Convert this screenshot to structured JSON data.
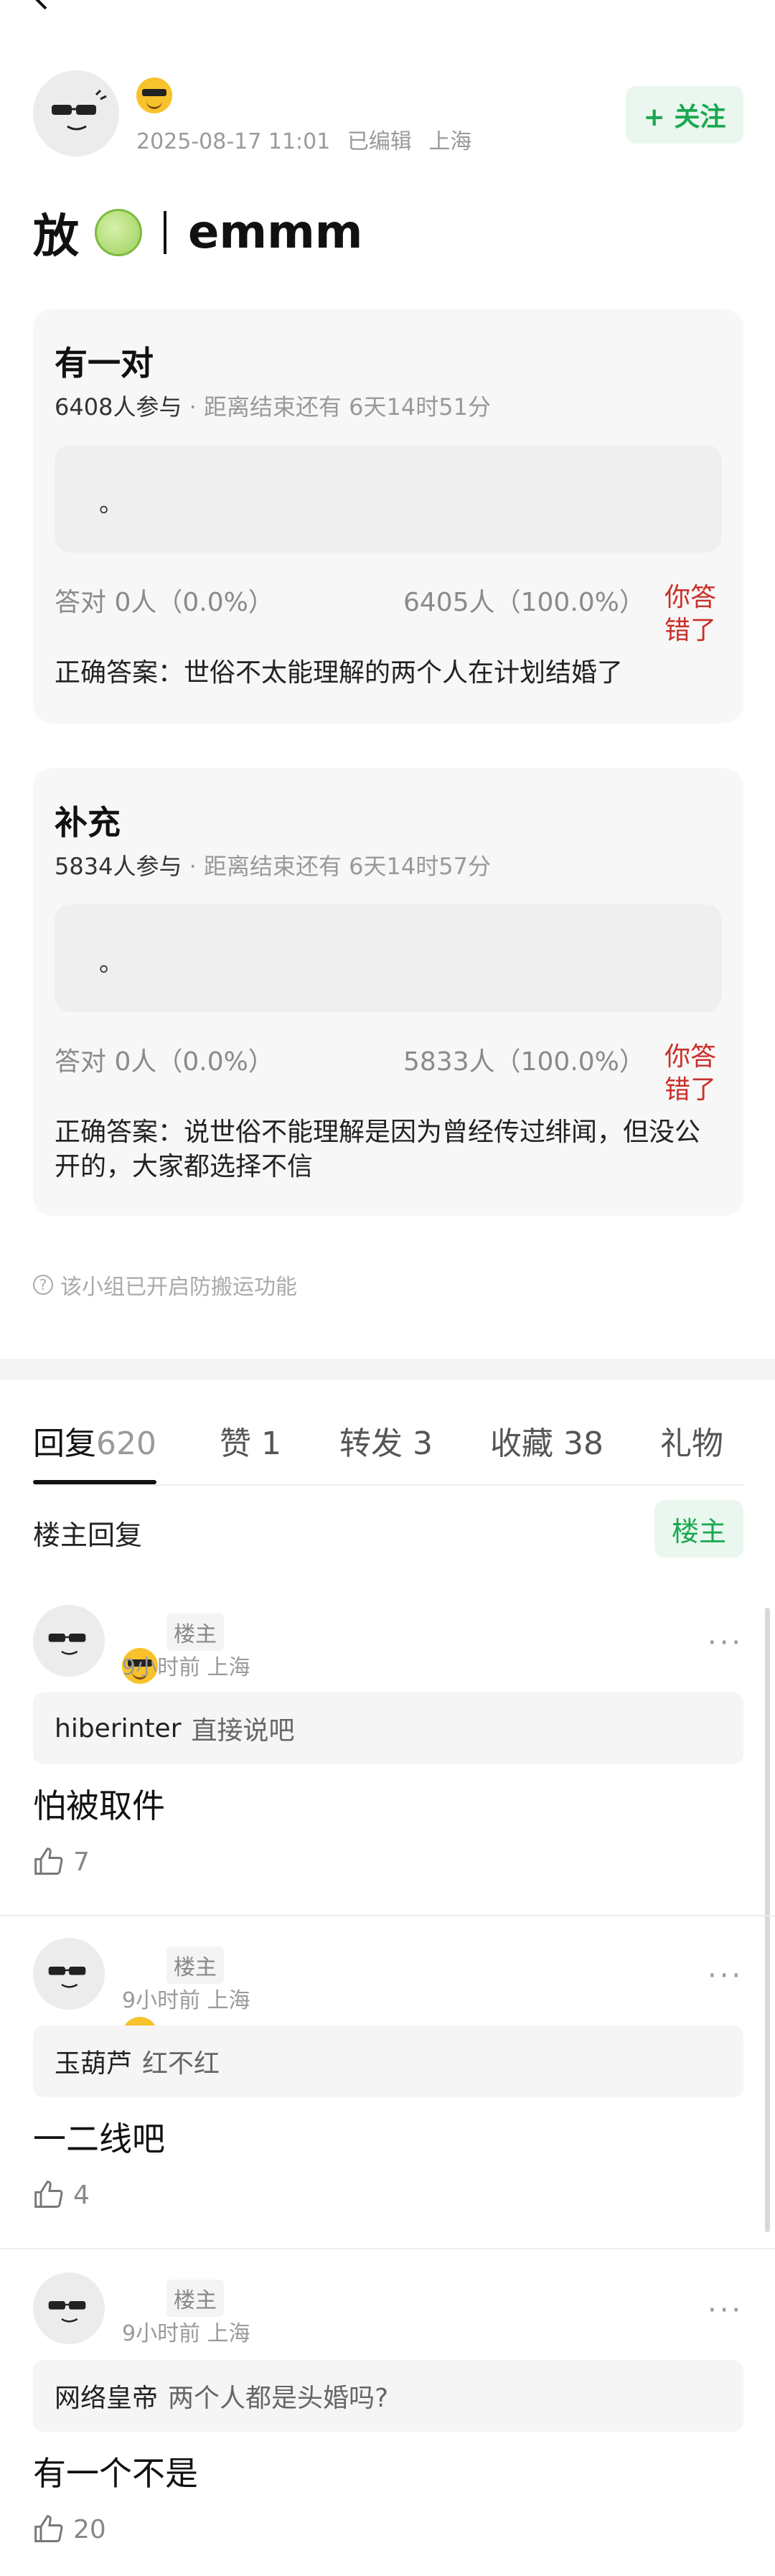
{
  "post": {
    "date": "2025-08-17 11:01",
    "edited": "已编辑",
    "location": "上海",
    "follow_label": "+ 关注",
    "title_left": "放",
    "title_right": "emmm"
  },
  "polls": [
    {
      "title": "有一对",
      "participants": "6408人参与",
      "deadline": "· 距离结束还有 6天14时51分",
      "option": "。",
      "correct_result": "答对  0人（0.0%）",
      "other_result": "6405人（100.0%）",
      "wrong_label": "你答错了",
      "answer": "正确答案：世俗不太能理解的两个人在计划结婚了"
    },
    {
      "title": "补充",
      "participants": "5834人参与",
      "deadline": "· 距离结束还有 6天14时57分",
      "option": "。",
      "correct_result": "答对  0人（0.0%）",
      "other_result": "5833人（100.0%）",
      "wrong_label": "你答错了",
      "answer": "正确答案：说世俗不能理解是因为曾经传过绯闻，但没公开的，大家都选择不信"
    }
  ],
  "guard_notice": "该小组已开启防搬运功能",
  "tabs": [
    {
      "label": "回复",
      "count": "620"
    },
    {
      "label": "赞",
      "count": "1"
    },
    {
      "label": "转发",
      "count": "3"
    },
    {
      "label": "收藏",
      "count": "38"
    },
    {
      "label": "礼物",
      "count": ""
    }
  ],
  "replies_header": {
    "label": "楼主回复",
    "button": "楼主"
  },
  "comments": [
    {
      "badge": "楼主",
      "meta": "9小时前 上海",
      "quote_name": "hiberinter",
      "quote_text": "直接说吧",
      "text": "怕被取件",
      "likes": "7"
    },
    {
      "badge": "楼主",
      "meta": "9小时前 上海",
      "quote_name": "玉葫芦",
      "quote_text": "红不红",
      "text": "一二线吧",
      "likes": "4"
    },
    {
      "badge": "楼主",
      "meta": "9小时前 上海",
      "quote_name": "网络皇帝",
      "quote_text": "两个人都是头婚吗?",
      "text": "有一个不是",
      "likes": "20"
    }
  ],
  "more_label": "···",
  "colors": {
    "accent": "#1aa84f",
    "wrong": "#c8302a"
  },
  "icons": [
    "back-icon",
    "sunglasses-emoji-icon",
    "melon-icon",
    "question-circle-icon",
    "thumb-up-icon",
    "more-icon"
  ]
}
